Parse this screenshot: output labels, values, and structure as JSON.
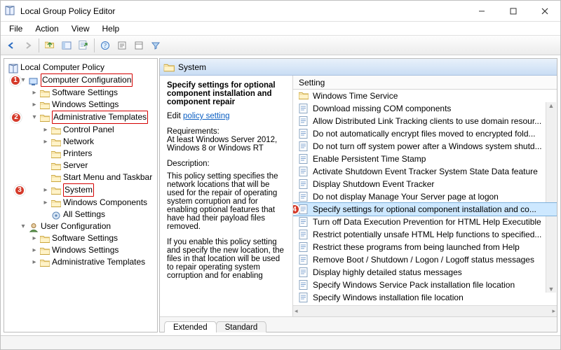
{
  "window": {
    "title": "Local Group Policy Editor"
  },
  "menu": {
    "file": "File",
    "action": "Action",
    "view": "View",
    "help": "Help"
  },
  "tree": {
    "root": "Local Computer Policy",
    "cc": "Computer Configuration",
    "cc_children": {
      "sw": "Software Settings",
      "ws": "Windows Settings",
      "at": "Administrative Templates",
      "at_children": {
        "cp": "Control Panel",
        "net": "Network",
        "pr": "Printers",
        "srv": "Server",
        "smt": "Start Menu and Taskbar",
        "sys": "System",
        "wc": "Windows Components",
        "all": "All Settings"
      }
    },
    "uc": "User Configuration",
    "uc_children": {
      "sw": "Software Settings",
      "ws": "Windows Settings",
      "at": "Administrative Templates"
    }
  },
  "right": {
    "hdr": "System",
    "setting_title": "Specify settings for optional component installation and component repair",
    "edit_label": "Edit",
    "edit_link": "policy setting",
    "req_label": "Requirements:",
    "req_text": "At least Windows Server 2012, Windows 8 or Windows RT",
    "desc_label": "Description:",
    "desc_text1": "This policy setting specifies the network locations that will be used for the repair of operating system corruption and for enabling optional features that have had their payload files removed.",
    "desc_text2": "If you enable this policy setting and specify the new location, the files in that location will be used to repair operating system corruption and for enabling",
    "col": "Setting",
    "rows": [
      "Windows Time Service",
      "Download missing COM components",
      "Allow Distributed Link Tracking clients to use domain resour...",
      "Do not automatically encrypt files moved to encrypted fold...",
      "Do not turn off system power after a Windows system shutd...",
      "Enable Persistent Time Stamp",
      "Activate Shutdown Event Tracker System State Data feature",
      "Display Shutdown Event Tracker",
      "Do not display Manage Your Server page at logon",
      "Specify settings for optional component installation and co...",
      "Turn off Data Execution Prevention for HTML Help Executible",
      "Restrict potentially unsafe HTML Help functions to specified...",
      "Restrict these programs from being launched from Help",
      "Remove Boot / Shutdown / Logon / Logoff status messages",
      "Display highly detailed status messages",
      "Specify Windows Service Pack installation file location",
      "Specify Windows installation file location"
    ],
    "row0_is_folder": true,
    "selected_index": 9
  },
  "tabs": {
    "ext": "Extended",
    "std": "Standard"
  },
  "callouts": {
    "c1": "1",
    "c2": "2",
    "c3": "3",
    "c4": "4"
  }
}
